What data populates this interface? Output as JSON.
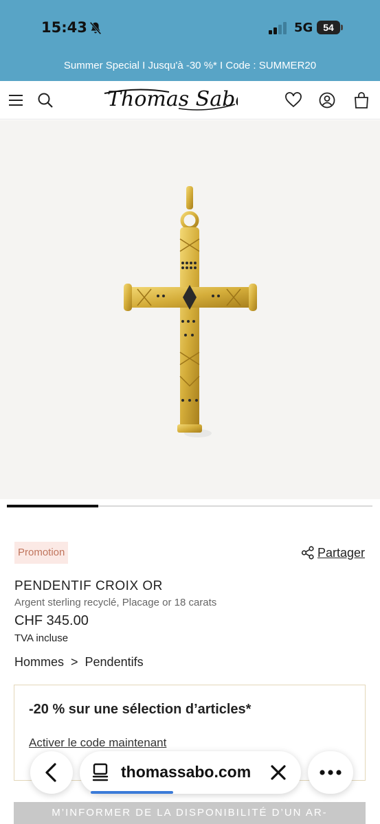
{
  "status_bar": {
    "time": "15:43",
    "network": "5G",
    "battery": "54",
    "icons": [
      "bell-slash-icon",
      "signal-icon",
      "battery-icon"
    ]
  },
  "banner": {
    "text": "Summer Special I Jusqu'à -30 %* I Code : SUMMER20",
    "color": "#58a4c6"
  },
  "header": {
    "logo": "Thomas Sabo",
    "icons": [
      "menu-icon",
      "search-icon",
      "heart-icon",
      "account-icon",
      "bag-icon"
    ]
  },
  "gallery": {
    "slide_position": 1,
    "slide_count": 4
  },
  "product": {
    "badge": "Promotion",
    "share_label": "Partager",
    "title": "PENDENTIF CROIX OR",
    "subtitle": "Argent sterling recyclé, Placage or 18 carats",
    "price": "CHF 345.00",
    "vat": "TVA incluse",
    "breadcrumb": [
      "Hommes",
      ">",
      "Pendentifs"
    ]
  },
  "offer": {
    "title": "-20 % sur une sélection d’articles*",
    "link": "Activer le code maintenant"
  },
  "notify_button": "M’INFORMER DE LA DISPONIBILITÉ D’UN AR-",
  "browser": {
    "url": "thomassabo.com",
    "icons": [
      "back-icon",
      "tabs-icon",
      "close-icon",
      "more-icon"
    ]
  },
  "colors": {
    "accent_gold": "#d4ad3a",
    "badge_text": "#c0755d",
    "badge_bg": "#fbe9e5",
    "progress": "#3b7bd8"
  }
}
